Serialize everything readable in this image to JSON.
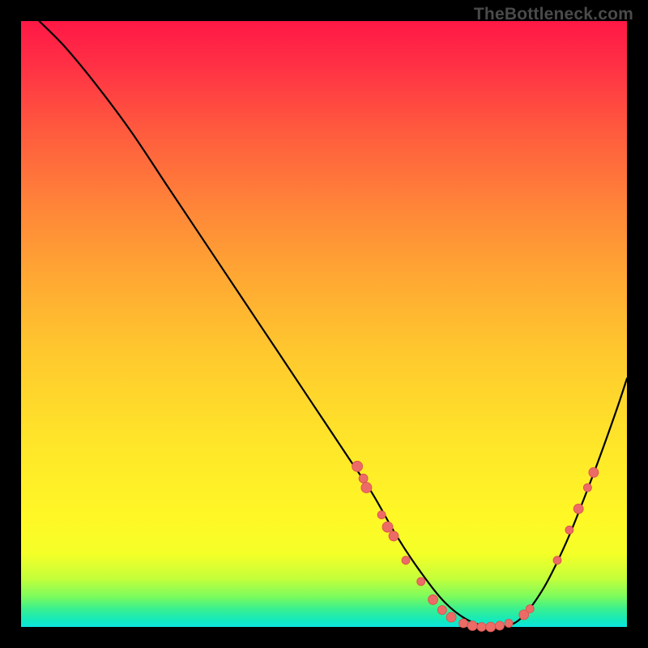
{
  "watermark": "TheBottleneck.com",
  "chart_data": {
    "type": "line",
    "title": "",
    "xlabel": "",
    "ylabel": "",
    "xlim": [
      0,
      100
    ],
    "ylim": [
      0,
      100
    ],
    "series": [
      {
        "name": "bottleneck-curve",
        "x": [
          3,
          7,
          12,
          18,
          24,
          30,
          36,
          42,
          48,
          54,
          58,
          62,
          66,
          70,
          74,
          78,
          82,
          86,
          90,
          94,
          98,
          100
        ],
        "y": [
          100,
          96,
          90,
          82,
          73,
          64,
          55,
          46,
          37,
          28,
          22,
          15,
          9,
          4,
          1,
          0,
          1,
          6,
          14,
          24,
          35,
          41
        ]
      }
    ],
    "scatter_points": {
      "name": "highlight-dots",
      "points": [
        {
          "x": 55.5,
          "y": 26.5,
          "r": 6.5
        },
        {
          "x": 56.5,
          "y": 24.5,
          "r": 5.5
        },
        {
          "x": 57.0,
          "y": 23.0,
          "r": 6.5
        },
        {
          "x": 59.5,
          "y": 18.5,
          "r": 5.0
        },
        {
          "x": 60.5,
          "y": 16.5,
          "r": 6.5
        },
        {
          "x": 61.5,
          "y": 15.0,
          "r": 6.0
        },
        {
          "x": 63.5,
          "y": 11.0,
          "r": 5.0
        },
        {
          "x": 66.0,
          "y": 7.5,
          "r": 5.0
        },
        {
          "x": 68.0,
          "y": 4.5,
          "r": 6.0
        },
        {
          "x": 69.5,
          "y": 2.8,
          "r": 5.5
        },
        {
          "x": 71.0,
          "y": 1.6,
          "r": 6.0
        },
        {
          "x": 73.0,
          "y": 0.6,
          "r": 5.5
        },
        {
          "x": 74.5,
          "y": 0.2,
          "r": 6.0
        },
        {
          "x": 76.0,
          "y": 0.0,
          "r": 5.5
        },
        {
          "x": 77.5,
          "y": 0.0,
          "r": 6.0
        },
        {
          "x": 79.0,
          "y": 0.2,
          "r": 5.5
        },
        {
          "x": 80.5,
          "y": 0.6,
          "r": 5.0
        },
        {
          "x": 83.0,
          "y": 2.0,
          "r": 6.0
        },
        {
          "x": 84.0,
          "y": 3.0,
          "r": 5.0
        },
        {
          "x": 88.5,
          "y": 11.0,
          "r": 5.0
        },
        {
          "x": 90.5,
          "y": 16.0,
          "r": 5.0
        },
        {
          "x": 92.0,
          "y": 19.5,
          "r": 6.0
        },
        {
          "x": 93.5,
          "y": 23.0,
          "r": 5.0
        },
        {
          "x": 94.5,
          "y": 25.5,
          "r": 6.0
        }
      ]
    },
    "background_gradient": {
      "top": "#ff1846",
      "mid": "#ffe629",
      "bottom": "#0ee4e0"
    }
  }
}
